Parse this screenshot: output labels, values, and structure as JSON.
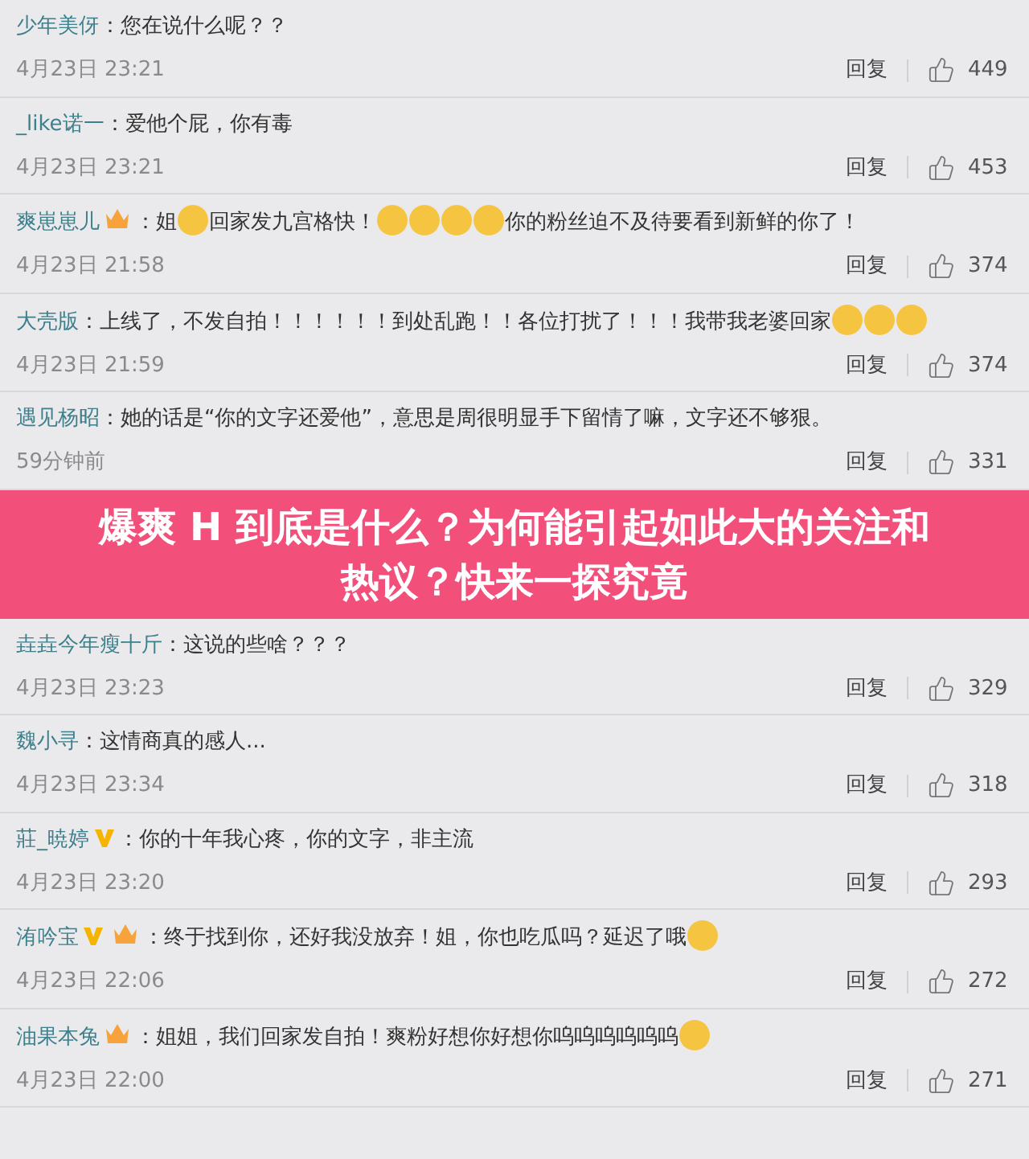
{
  "comments_before": [
    {
      "user": "少年美伢",
      "verified": false,
      "vip": false,
      "colon": "：",
      "content": [
        {
          "kind": "text",
          "text": "您在说什么呢？？"
        }
      ],
      "time": "4月23日 23:21",
      "reply": "回复",
      "likes": "449"
    },
    {
      "user": "_like诺一",
      "verified": false,
      "vip": false,
      "colon": "：",
      "content": [
        {
          "kind": "text",
          "text": "爱他个屁，你有毒"
        }
      ],
      "time": "4月23日 23:21",
      "reply": "回复",
      "likes": "453"
    },
    {
      "user": "爽崽崽儿",
      "verified": false,
      "vip": true,
      "colon": "：",
      "content": [
        {
          "kind": "text",
          "text": "姐"
        },
        {
          "kind": "emoji"
        },
        {
          "kind": "text",
          "text": "回家发九宫格快！"
        },
        {
          "kind": "emoji"
        },
        {
          "kind": "emoji"
        },
        {
          "kind": "emoji"
        },
        {
          "kind": "emoji"
        },
        {
          "kind": "text",
          "text": "你的粉丝迫不及待要看到新鲜的你了！"
        }
      ],
      "time": "4月23日 21:58",
      "reply": "回复",
      "likes": "374"
    },
    {
      "user": "大壳版",
      "verified": false,
      "vip": false,
      "colon": "：",
      "content": [
        {
          "kind": "text",
          "text": "上线了，不发自拍！！！！！！到处乱跑！！各位打扰了！！！我带我老婆回家"
        },
        {
          "kind": "emoji"
        },
        {
          "kind": "emoji"
        },
        {
          "kind": "emoji"
        }
      ],
      "time": "4月23日 21:59",
      "reply": "回复",
      "likes": "374"
    },
    {
      "user": "遇见杨昭",
      "verified": false,
      "vip": false,
      "colon": "：",
      "content": [
        {
          "kind": "text",
          "text": "她的话是“你的文字还爱他”，意思是周很明显手下留情了嘛，文字还不够狠。"
        }
      ],
      "time": "59分钟前",
      "reply": "回复",
      "likes": "331"
    }
  ],
  "banner": {
    "text": "爆爽 H 到底是什么？为何能引起如此大的关注和热议？快来一探究竟"
  },
  "comments_after": [
    {
      "user": "垚垚今年瘦十斤",
      "verified": false,
      "vip": false,
      "colon": "：",
      "content": [
        {
          "kind": "text",
          "text": "这说的些啥？？？"
        }
      ],
      "time": "4月23日 23:23",
      "reply": "回复",
      "likes": "329"
    },
    {
      "user": "魏小寻",
      "verified": false,
      "vip": false,
      "colon": "：",
      "content": [
        {
          "kind": "text",
          "text": "这情商真的感人..."
        }
      ],
      "time": "4月23日 23:34",
      "reply": "回复",
      "likes": "318"
    },
    {
      "user": "莊_暁婷",
      "verified": true,
      "vip": false,
      "colon": "：",
      "content": [
        {
          "kind": "text",
          "text": "你的十年我心疼，你的文字，非主流"
        }
      ],
      "time": "4月23日 23:20",
      "reply": "回复",
      "likes": "293"
    },
    {
      "user": "洧吟宝",
      "verified": true,
      "vip": true,
      "colon": "：",
      "content": [
        {
          "kind": "text",
          "text": "终于找到你，还好我没放弃！姐，你也吃瓜吗？延迟了哦"
        },
        {
          "kind": "emoji"
        }
      ],
      "time": "4月23日 22:06",
      "reply": "回复",
      "likes": "272"
    },
    {
      "user": "油果本兔",
      "verified": false,
      "vip": true,
      "colon": "：",
      "content": [
        {
          "kind": "text",
          "text": "姐姐，我们回家发自拍！爽粉好想你好想你呜呜呜呜呜呜"
        },
        {
          "kind": "emoji"
        }
      ],
      "time": "4月23日 22:00",
      "reply": "回复",
      "likes": "271"
    }
  ]
}
